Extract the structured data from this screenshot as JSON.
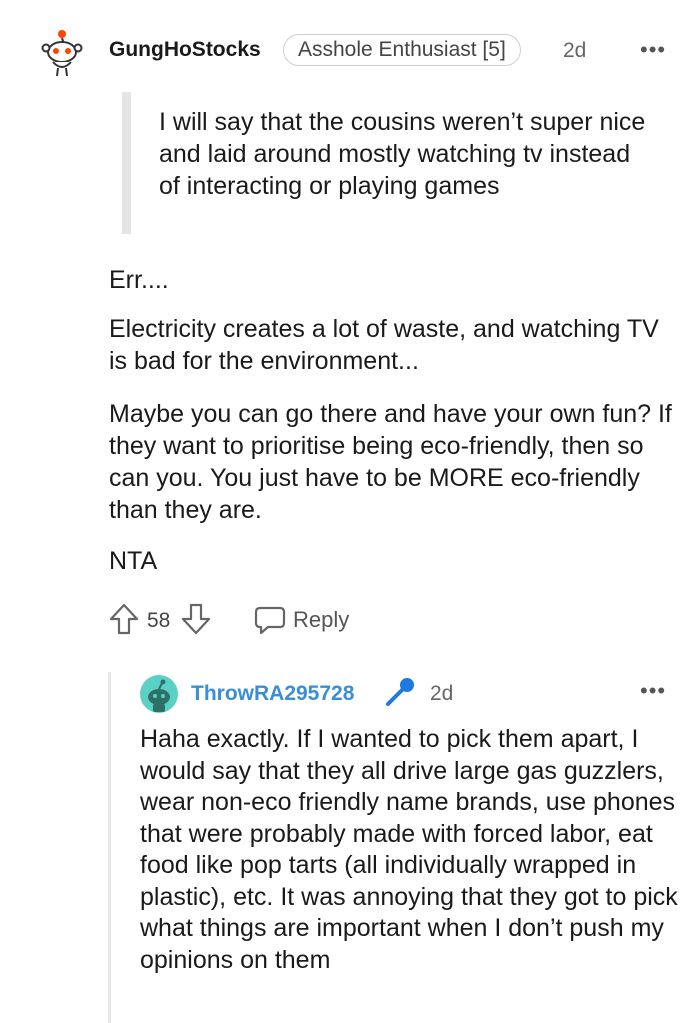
{
  "comment": {
    "username": "GungHoStocks",
    "flair": "Asshole Enthusiast [5]",
    "time": "2d",
    "more": "•••",
    "quote": "I will say that the cousins weren’t super nice and laid around mostly watching tv instead of interacting or playing games",
    "paragraphs": [
      "Err....",
      "Electricity creates a lot of waste, and watching TV is bad for the environment...",
      "Maybe you can go there and have your own fun? If they want to prioritise being eco-friendly, then so can you. You just have to be MORE eco-friendly than they are.",
      "NTA"
    ],
    "score": "58",
    "reply_label": "Reply"
  },
  "reply": {
    "username": "ThrowRA295728",
    "time": "2d",
    "more": "•••",
    "body": "Haha exactly. If I wanted to pick them apart, I would say that they all drive large gas guzzlers, wear non-eco friendly name brands, use phones that were probably made with forced labor, eat food like pop tarts (all individually wrapped in plastic), etc. It was annoying that they got to pick what things are important when I don’t push my opinions on them"
  },
  "colors": {
    "op_username_color": "#1a1a1b",
    "reply_username_color": "#3a8ed6",
    "avatar_teal": "#5bd1c5",
    "mic_blue": "#1f7ae0"
  }
}
